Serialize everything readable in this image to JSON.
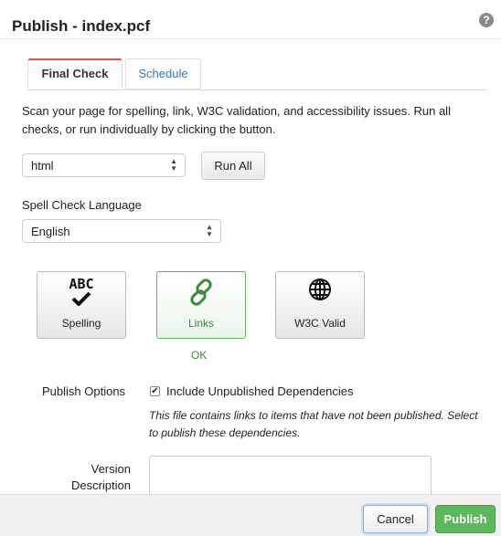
{
  "dialog": {
    "title": "Publish - index.pcf",
    "help_icon": "question-circle-icon",
    "help_glyph": "?"
  },
  "tabs": [
    {
      "label": "Final Check",
      "active": true
    },
    {
      "label": "Schedule",
      "active": false
    }
  ],
  "final_check": {
    "instructions": "Scan your page for spelling, link, W3C validation, and accessibility issues. Run all checks, or run individually by clicking the button.",
    "check_type_select": {
      "value": "html"
    },
    "run_all_label": "Run All",
    "spell_check_language_label": "Spell Check Language",
    "language_select": {
      "value": "English"
    },
    "checks": [
      {
        "label": "Spelling",
        "icon": "abc-check-icon",
        "icon_text": "ABC",
        "status": ""
      },
      {
        "label": "Links",
        "icon": "link-icon",
        "status": "OK"
      },
      {
        "label": "W3C Valid",
        "icon": "globe-icon",
        "status": ""
      }
    ]
  },
  "publish_options": {
    "label": "Publish Options",
    "include_unpublished_dependencies": {
      "label": "Include Unpublished Dependencies",
      "checked": true,
      "check_glyph": "✔"
    },
    "note": "This file contains links to items that have not been published. Select to publish these dependencies.",
    "version_description_label": "Version Description",
    "version_description_value": ""
  },
  "footer": {
    "cancel_label": "Cancel",
    "publish_label": "Publish"
  },
  "colors": {
    "active_tab_accent": "#d9534f",
    "link_blue": "#337ab7",
    "success_green": "#5cb85c",
    "ok_text_green": "#3c8a3c"
  },
  "select_arrows": {
    "up": "▲",
    "down": "▼"
  }
}
